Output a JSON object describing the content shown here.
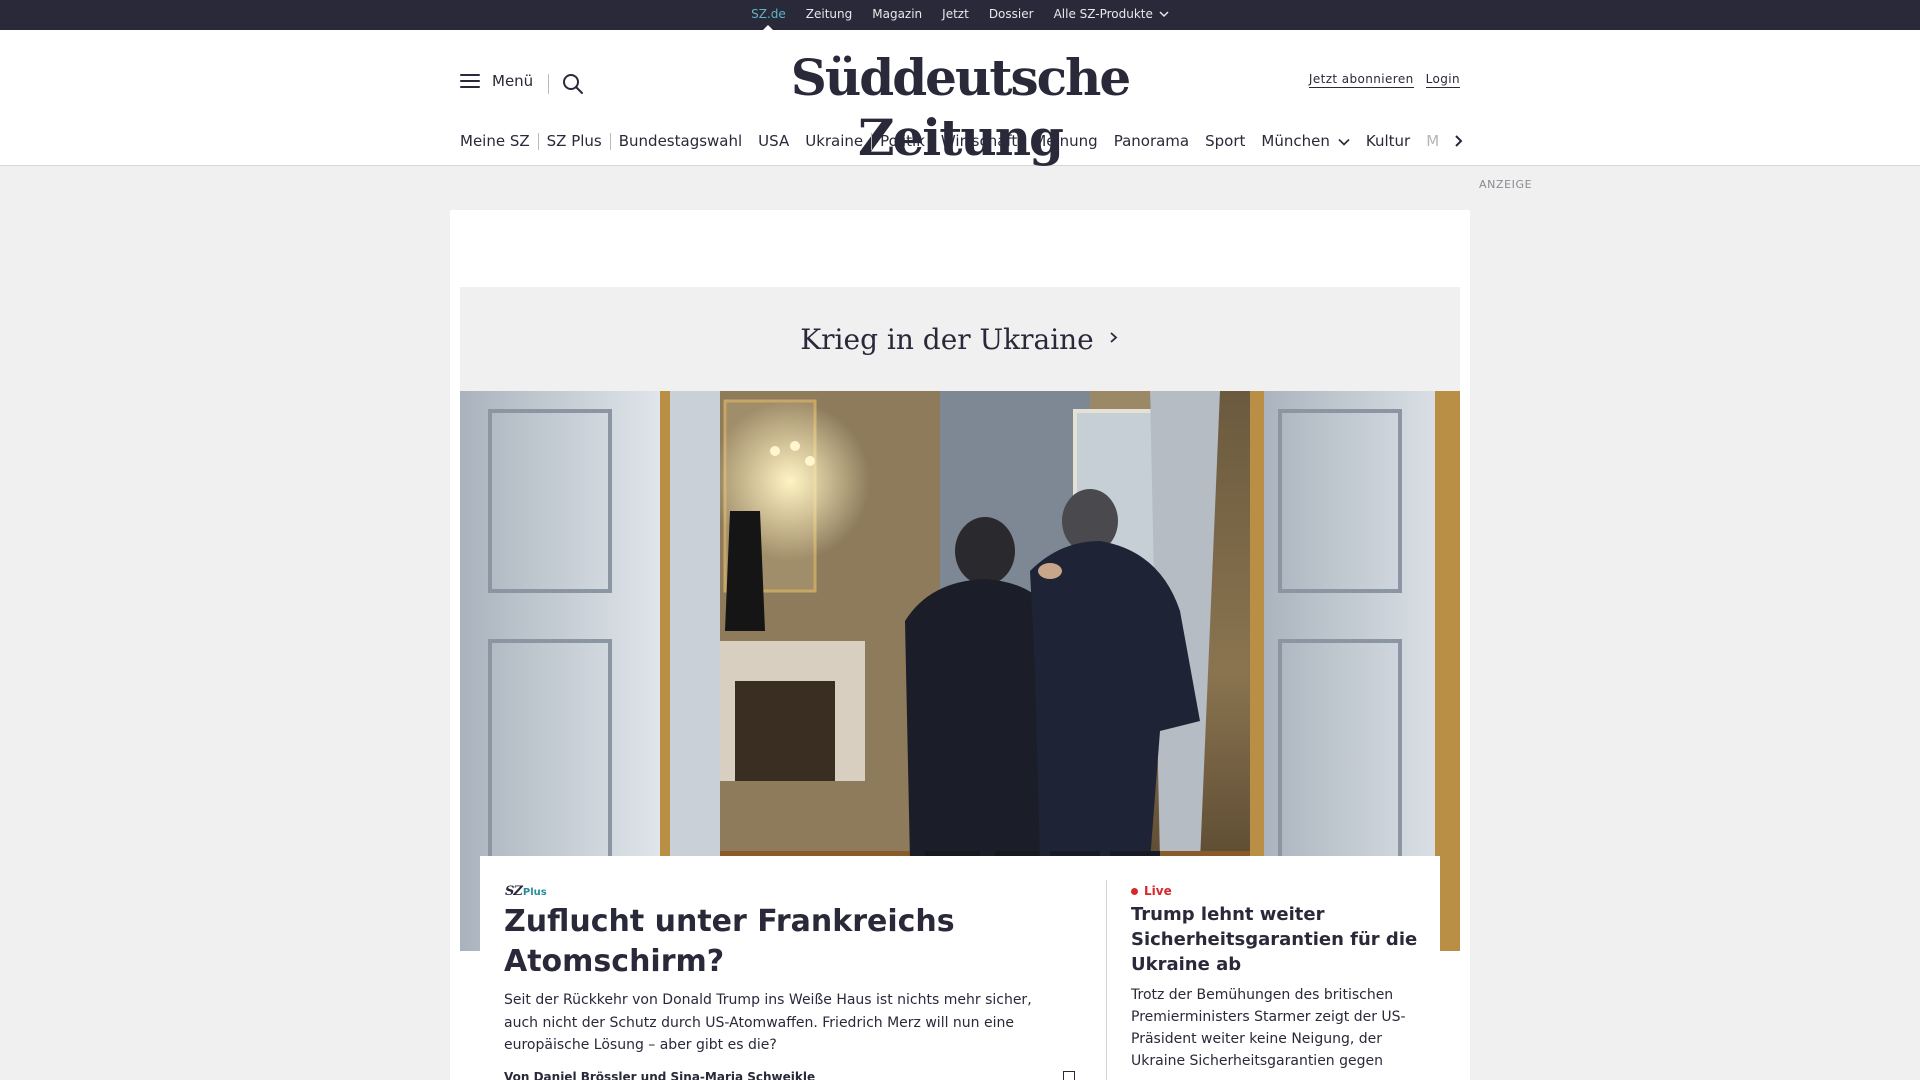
{
  "topbar": {
    "items": [
      "SZ.de",
      "Zeitung",
      "Magazin",
      "Jetzt",
      "Dossier",
      "Alle SZ-Produkte"
    ],
    "active": "SZ.de"
  },
  "header": {
    "menu_label": "Menü",
    "logo": "Süddeutsche Zeitung",
    "subscribe_label": "Jetzt abonnieren",
    "login_label": "Login"
  },
  "nav": {
    "items": [
      "Meine SZ",
      "SZ Plus",
      "Bundestagswahl",
      "USA",
      "Ukraine",
      "Politik",
      "Wirtschaft",
      "Meinung",
      "Panorama",
      "Sport",
      "München",
      "Kultur",
      "M"
    ]
  },
  "ad_label": "ANZEIGE",
  "section": {
    "title": "Krieg in der Ukraine"
  },
  "lead": {
    "badge_sz": "SZ",
    "badge_plus": "Plus",
    "headline": "Zuflucht unter Frankreichs Atomschirm?",
    "teaser": "Seit der Rückkehr von Donald Trump ins Weiße Haus ist nichts mehr sicher, auch nicht der Schutz durch US-Atomwaffen. Friedrich Merz will nun eine europäische Lösung – aber gibt es die?",
    "authors": "Von Daniel Brössler und Sina-Maria Schweikle"
  },
  "side": {
    "live_label": "Live",
    "headline": "Trump lehnt weiter Sicherheitsgarantien für die Ukraine ab",
    "teaser": "Trotz der Bemühungen des britischen Premierministers Starmer zeigt der US-Präsident weiter keine Neigung, der Ukraine Sicherheitsgarantien gegen"
  },
  "colors": {
    "topbar_bg": "#29293a",
    "active_link": "#5fb4c2",
    "live_red": "#d6272b",
    "plus_teal": "#2a8c97"
  }
}
